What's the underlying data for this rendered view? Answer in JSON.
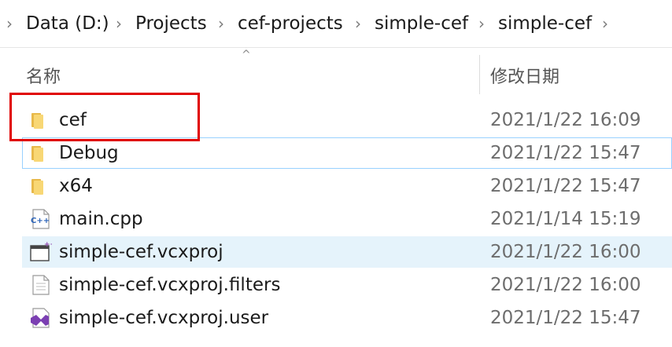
{
  "breadcrumb": [
    "Data (D:)",
    "Projects",
    "cef-projects",
    "simple-cef",
    "simple-cef"
  ],
  "columns": {
    "name": "名称",
    "modified": "修改日期"
  },
  "files": [
    {
      "name": "cef",
      "date": "2021/1/22 16:09",
      "type": "folder"
    },
    {
      "name": "Debug",
      "date": "2021/1/22 15:47",
      "type": "folder"
    },
    {
      "name": "x64",
      "date": "2021/1/22 15:47",
      "type": "folder"
    },
    {
      "name": "main.cpp",
      "date": "2021/1/14 15:19",
      "type": "cpp"
    },
    {
      "name": "simple-cef.vcxproj",
      "date": "2021/1/22 16:00",
      "type": "vcxproj"
    },
    {
      "name": "simple-cef.vcxproj.filters",
      "date": "2021/1/22 16:00",
      "type": "generic"
    },
    {
      "name": "simple-cef.vcxproj.user",
      "date": "2021/1/22 15:47",
      "type": "vs-user"
    }
  ],
  "colors": {
    "highlight": "#e00000",
    "hover": "#e5f3fb",
    "folder": "#f8d775"
  }
}
